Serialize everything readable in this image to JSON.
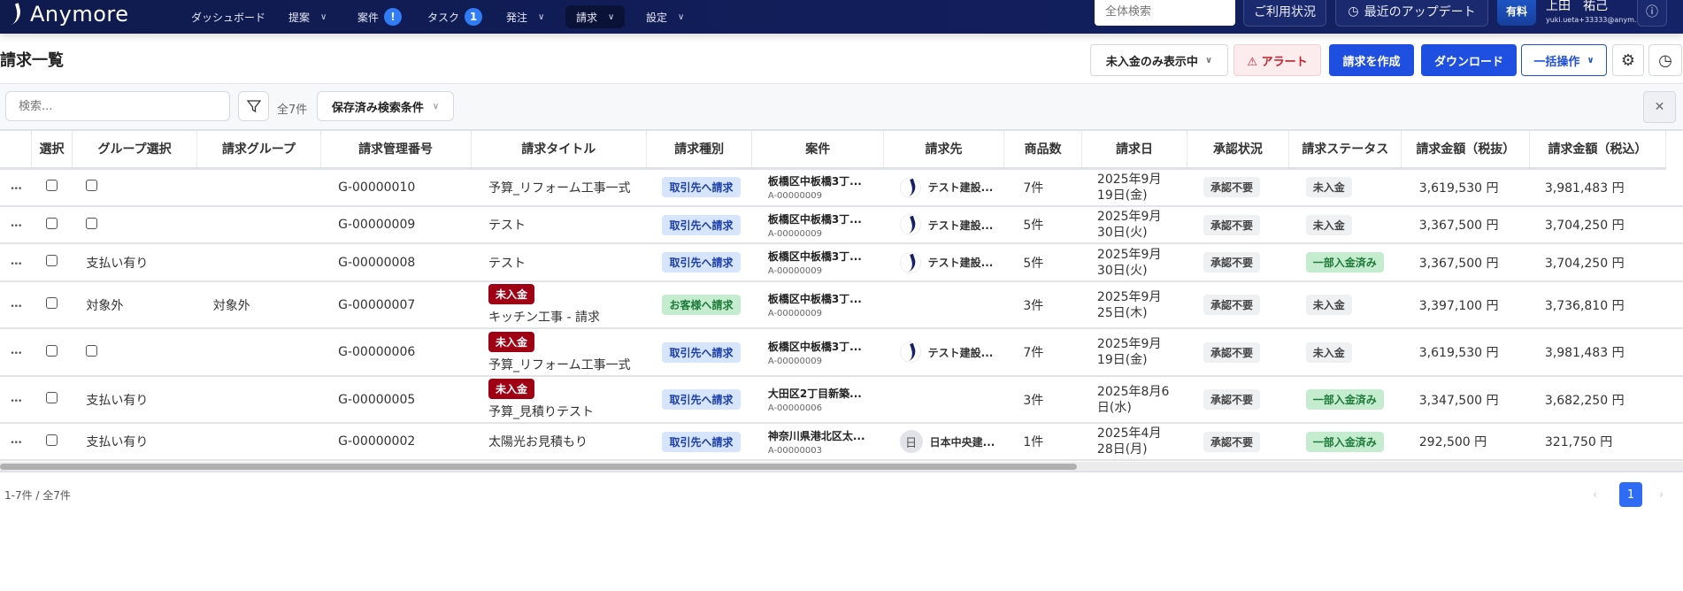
{
  "app": {
    "name": "Anymore"
  },
  "nav": [
    {
      "label": "ダッシュボード"
    },
    {
      "label": "提案",
      "dropdown": true
    },
    {
      "label": "案件",
      "badge": "!"
    },
    {
      "label": "タスク",
      "badge": "1"
    },
    {
      "label": "発注",
      "dropdown": true
    },
    {
      "label": "請求",
      "dropdown": true,
      "active": true
    },
    {
      "label": "設定",
      "dropdown": true
    }
  ],
  "topright": {
    "search_placeholder": "全体検索",
    "usage": "ご利用状況",
    "updates": "最近のアップデート",
    "plan": "有料",
    "user_name": "上田　祐己",
    "user_email": "yuki.ueta+33333@anym..."
  },
  "page": {
    "title": "請求一覧",
    "unpaid_filter": "未入金のみ表示中",
    "alert": "⚠ アラート",
    "create": "請求を作成",
    "download": "ダウンロード",
    "bulk": "一括操作"
  },
  "toolbar": {
    "search_placeholder": "検索...",
    "total": "全7件",
    "saved": "保存済み検索条件"
  },
  "columns": [
    "",
    "選択",
    "グループ選択",
    "請求グループ",
    "請求管理番号",
    "請求タイトル",
    "請求種別",
    "案件",
    "請求先",
    "商品数",
    "請求日",
    "承認状況",
    "請求ステータス",
    "請求金額（税抜）",
    "請求金額（税込）"
  ],
  "rows": [
    {
      "group_select": "",
      "group": "",
      "number": "G-00000010",
      "unpaid": "",
      "title": "予算_リフォーム工事一式",
      "type": "取引先へ請求",
      "type_color": "blue",
      "case": "板橋区中板橋3丁...",
      "case_id": "A-00000009",
      "client": "テスト建設...",
      "client_logo": "logo",
      "qty": "7件",
      "date1": "2025年9月",
      "date2": "19日(金)",
      "approval": "承認不要",
      "status": "未入金",
      "status_color": "gray",
      "amount": "3,619,530 円",
      "amount_tax": "3,981,483 円"
    },
    {
      "group_select": "",
      "group": "",
      "number": "G-00000009",
      "unpaid": "",
      "title": "テスト",
      "type": "取引先へ請求",
      "type_color": "blue",
      "case": "板橋区中板橋3丁...",
      "case_id": "A-00000009",
      "client": "テスト建設...",
      "client_logo": "logo",
      "qty": "5件",
      "date1": "2025年9月",
      "date2": "30日(火)",
      "approval": "承認不要",
      "status": "未入金",
      "status_color": "gray",
      "amount": "3,367,500 円",
      "amount_tax": "3,704,250 円"
    },
    {
      "group_select": "支払い有り",
      "group": "",
      "number": "G-00000008",
      "unpaid": "",
      "title": "テスト",
      "type": "取引先へ請求",
      "type_color": "blue",
      "case": "板橋区中板橋3丁...",
      "case_id": "A-00000009",
      "client": "テスト建設...",
      "client_logo": "logo",
      "qty": "5件",
      "date1": "2025年9月",
      "date2": "30日(火)",
      "approval": "承認不要",
      "status": "一部入金済み",
      "status_color": "green",
      "amount": "3,367,500 円",
      "amount_tax": "3,704,250 円"
    },
    {
      "group_select": "対象外",
      "group": "対象外",
      "number": "G-00000007",
      "unpaid": "未入金",
      "title": "キッチン工事 - 請求",
      "type": "お客様へ請求",
      "type_color": "green",
      "case": "板橋区中板橋3丁...",
      "case_id": "A-00000009",
      "client": "",
      "client_logo": "",
      "qty": "3件",
      "date1": "2025年9月",
      "date2": "25日(木)",
      "approval": "承認不要",
      "status": "未入金",
      "status_color": "gray",
      "amount": "3,397,100 円",
      "amount_tax": "3,736,810 円"
    },
    {
      "group_select": "",
      "group": "",
      "number": "G-00000006",
      "unpaid": "未入金",
      "title": "予算_リフォーム工事一式",
      "type": "取引先へ請求",
      "type_color": "blue",
      "case": "板橋区中板橋3丁...",
      "case_id": "A-00000009",
      "client": "テスト建設...",
      "client_logo": "logo",
      "qty": "7件",
      "date1": "2025年9月",
      "date2": "19日(金)",
      "approval": "承認不要",
      "status": "未入金",
      "status_color": "gray",
      "amount": "3,619,530 円",
      "amount_tax": "3,981,483 円"
    },
    {
      "group_select": "支払い有り",
      "group": "",
      "number": "G-00000005",
      "unpaid": "未入金",
      "title": "予算_見積りテスト",
      "type": "取引先へ請求",
      "type_color": "blue",
      "case": "大田区2丁目新築...",
      "case_id": "A-00000006",
      "client": "",
      "client_logo": "",
      "qty": "3件",
      "date1": "2025年8月6",
      "date2": "日(水)",
      "approval": "承認不要",
      "status": "一部入金済み",
      "status_color": "green",
      "amount": "3,347,500 円",
      "amount_tax": "3,682,250 円"
    },
    {
      "group_select": "支払い有り",
      "group": "",
      "number": "G-00000002",
      "unpaid": "",
      "title": "太陽光お見積もり",
      "type": "取引先へ請求",
      "type_color": "blue",
      "case": "神奈川県港北区太...",
      "case_id": "A-00000003",
      "client": "日本中央建...",
      "client_logo": "日",
      "qty": "1件",
      "date1": "2025年4月",
      "date2": "28日(月)",
      "approval": "承認不要",
      "status": "一部入金済み",
      "status_color": "green",
      "amount": "292,500 円",
      "amount_tax": "321,750 円"
    }
  ],
  "scroll": {
    "horizontal_fraction": 0.64
  },
  "footer": {
    "range": "1-7件 / 全7件",
    "current_page": "1",
    "prev": "‹",
    "next": "›"
  },
  "colors": {
    "nav_bg": "#0f1a4d",
    "primary": "#1f4fe0",
    "unpaid_red": "#a00014"
  }
}
